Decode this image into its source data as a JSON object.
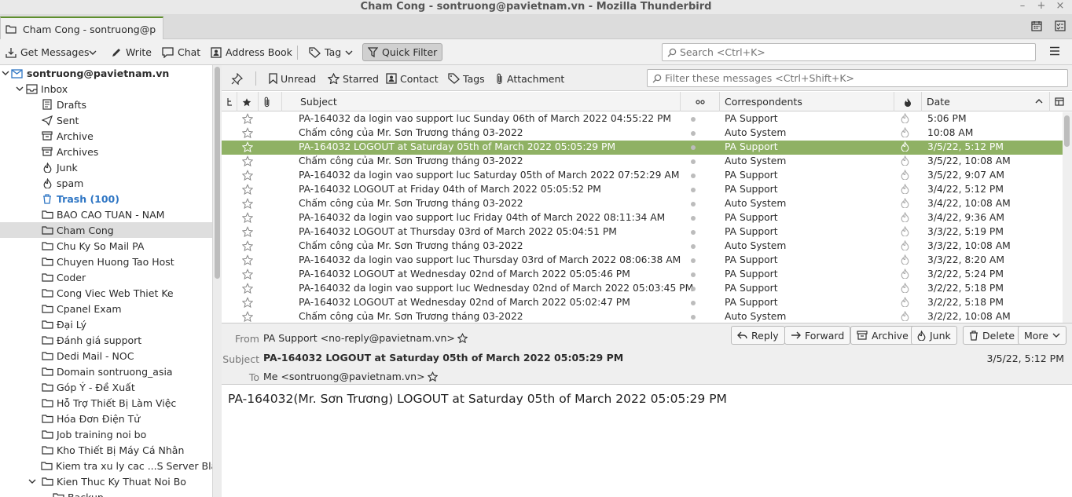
{
  "window": {
    "title": "Cham Cong - sontruong@pavietnam.vn - Mozilla Thunderbird",
    "controls": [
      "–",
      "+",
      "×"
    ]
  },
  "tab": {
    "label": "Cham Cong - sontruong@pavi"
  },
  "toolbar": {
    "get_messages": "Get Messages",
    "write": "Write",
    "chat": "Chat",
    "address_book": "Address Book",
    "tag": "Tag",
    "quick_filter": "Quick Filter",
    "search_placeholder": "Search <Ctrl+K>"
  },
  "folders": {
    "account": "sontruong@pavietnam.vn",
    "inbox": "Inbox",
    "items": [
      {
        "label": "Drafts",
        "icon": "drafts-icon"
      },
      {
        "label": "Sent",
        "icon": "sent-icon"
      },
      {
        "label": "Archive",
        "icon": "archive-icon"
      },
      {
        "label": "Archives",
        "icon": "archive-icon"
      },
      {
        "label": "Junk",
        "icon": "junk-icon"
      },
      {
        "label": "spam",
        "icon": "junk-icon"
      },
      {
        "label": "Trash (100)",
        "icon": "trash-icon"
      },
      {
        "label": "BAO CAO TUAN - NAM",
        "icon": "folder-icon"
      },
      {
        "label": "Cham Cong",
        "icon": "folder-icon"
      },
      {
        "label": "Chu Ky So Mail PA",
        "icon": "folder-icon"
      },
      {
        "label": "Chuyen Huong Tao Host",
        "icon": "folder-icon"
      },
      {
        "label": "Coder",
        "icon": "folder-icon"
      },
      {
        "label": "Cong Viec Web Thiet Ke",
        "icon": "folder-icon"
      },
      {
        "label": "Cpanel Exam",
        "icon": "folder-icon"
      },
      {
        "label": "Đại Lý",
        "icon": "folder-icon"
      },
      {
        "label": "Đánh giá support",
        "icon": "folder-icon"
      },
      {
        "label": "Dedi Mail - NOC",
        "icon": "folder-icon"
      },
      {
        "label": "Domain sontruong_asia",
        "icon": "folder-icon"
      },
      {
        "label": "Góp Ý - Đề Xuất",
        "icon": "folder-icon"
      },
      {
        "label": "Hỗ Trợ Thiết Bị Làm Việc",
        "icon": "folder-icon"
      },
      {
        "label": "Hóa Đơn Điện Tử",
        "icon": "folder-icon"
      },
      {
        "label": "Job training noi bo",
        "icon": "folder-icon"
      },
      {
        "label": "Kho Thiết Bị Máy Cá Nhân",
        "icon": "folder-icon"
      },
      {
        "label": "Kiem tra xu ly cac ...S Server Blacklis",
        "icon": "folder-icon"
      },
      {
        "label": "Kien Thuc Ky Thuat Noi Bo",
        "icon": "folder-icon"
      },
      {
        "label": "Backup",
        "icon": "folder-icon"
      }
    ]
  },
  "quickfilter": {
    "unread": "Unread",
    "starred": "Starred",
    "contact": "Contact",
    "tags": "Tags",
    "attachment": "Attachment",
    "filter_placeholder": "Filter these messages <Ctrl+Shift+K>"
  },
  "columns": {
    "subject": "Subject",
    "correspondents": "Correspondents",
    "date": "Date"
  },
  "messages": [
    {
      "subject": "PA-164032 da login vao support luc Sunday 06th of March 2022 04:55:22 PM",
      "from": "PA Support",
      "date": "5:06 PM"
    },
    {
      "subject": "Chấm công của Mr. Sơn Trương tháng 03-2022",
      "from": "Auto System",
      "date": "10:08 AM"
    },
    {
      "subject": "PA-164032 LOGOUT at Saturday 05th of March 2022 05:05:29 PM",
      "from": "PA Support",
      "date": "3/5/22, 5:12 PM"
    },
    {
      "subject": "Chấm công của Mr. Sơn Trương tháng 03-2022",
      "from": "Auto System",
      "date": "3/5/22, 10:08 AM"
    },
    {
      "subject": "PA-164032 da login vao support luc Saturday 05th of March 2022 07:52:29 AM",
      "from": "PA Support",
      "date": "3/5/22, 9:07 AM"
    },
    {
      "subject": "PA-164032 LOGOUT at Friday 04th of March 2022 05:05:52 PM",
      "from": "PA Support",
      "date": "3/4/22, 5:12 PM"
    },
    {
      "subject": "Chấm công của Mr. Sơn Trương tháng 03-2022",
      "from": "Auto System",
      "date": "3/4/22, 10:08 AM"
    },
    {
      "subject": "PA-164032 da login vao support luc Friday 04th of March 2022 08:11:34 AM",
      "from": "PA Support",
      "date": "3/4/22, 9:36 AM"
    },
    {
      "subject": "PA-164032 LOGOUT at Thursday 03rd of March 2022 05:04:51 PM",
      "from": "PA Support",
      "date": "3/3/22, 5:19 PM"
    },
    {
      "subject": "Chấm công của Mr. Sơn Trương tháng 03-2022",
      "from": "Auto System",
      "date": "3/3/22, 10:08 AM"
    },
    {
      "subject": "PA-164032 da login vao support luc Thursday 03rd of March 2022 08:06:38 AM",
      "from": "PA Support",
      "date": "3/3/22, 8:20 AM"
    },
    {
      "subject": "PA-164032 LOGOUT at Wednesday 02nd of March 2022 05:05:46 PM",
      "from": "PA Support",
      "date": "3/2/22, 5:24 PM"
    },
    {
      "subject": "PA-164032 da login vao support luc Wednesday 02nd of March 2022 05:03:45 PM",
      "from": "PA Support",
      "date": "3/2/22, 5:18 PM"
    },
    {
      "subject": "PA-164032 LOGOUT at Wednesday 02nd of March 2022 05:02:47 PM",
      "from": "PA Support",
      "date": "3/2/22, 5:18 PM"
    },
    {
      "subject": "Chấm công của Mr. Sơn Trương tháng 03-2022",
      "from": "Auto System",
      "date": "3/2/22, 10:08 AM"
    }
  ],
  "header": {
    "from_label": "From",
    "from": "PA Support <no-reply@pavietnam.vn>",
    "subject_label": "Subject",
    "subject": "PA-164032 LOGOUT at Saturday 05th of March 2022 05:05:29 PM",
    "to_label": "To",
    "to": "Me <sontruong@pavietnam.vn>",
    "date": "3/5/22, 5:12 PM",
    "reply": "Reply",
    "forward": "Forward",
    "archive": "Archive",
    "junk": "Junk",
    "delete": "Delete",
    "more": "More"
  },
  "body": {
    "text": "PA-164032(Mr. Sơn Trương) LOGOUT at Saturday 05th of March 2022 05:05:29 PM"
  },
  "colors": {
    "selected_row": "#8fb164",
    "tab_accent": "#5e8e2d",
    "trash": "#2f76c4"
  }
}
